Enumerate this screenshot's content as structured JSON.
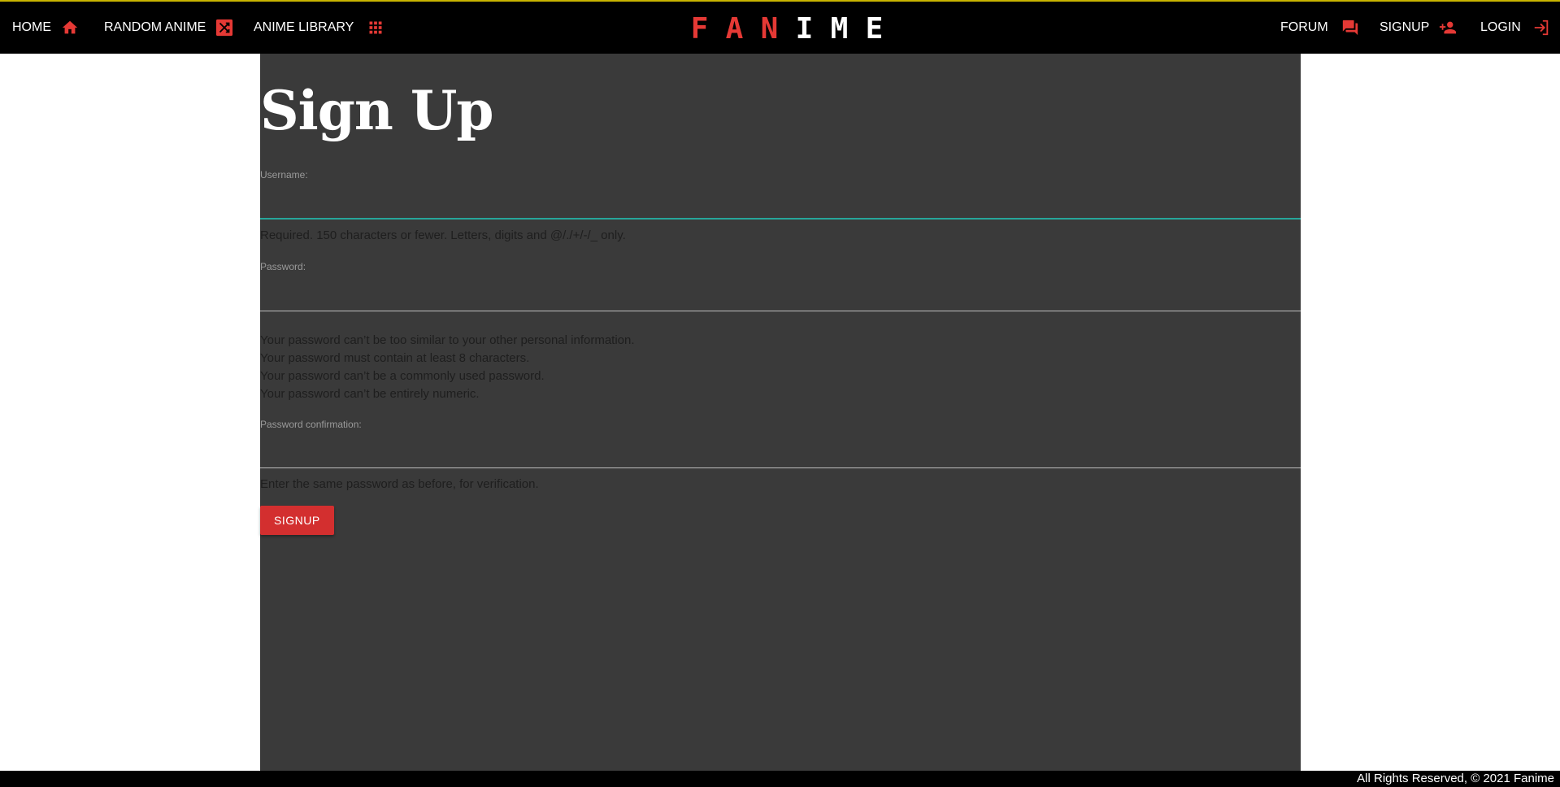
{
  "nav": {
    "left": [
      {
        "label": "HOME",
        "icon": "home-icon"
      },
      {
        "label": "RANDOM ANIME",
        "icon": "shuffle-icon"
      },
      {
        "label": "ANIME LIBRARY",
        "icon": "grid-icon"
      }
    ],
    "brand": [
      "F",
      "A",
      "N",
      "I",
      "M",
      "E"
    ],
    "right": [
      {
        "label": "FORUM",
        "icon": "forum-icon"
      },
      {
        "label": "SIGNUP",
        "icon": "person-add-icon"
      },
      {
        "label": "LOGIN",
        "icon": "login-icon"
      }
    ]
  },
  "form": {
    "title": "Sign Up",
    "username": {
      "label": "Username:",
      "value": "",
      "help": "Required. 150 characters or fewer. Letters, digits and @/./+/-/_ only."
    },
    "password": {
      "label": "Password:",
      "value": "",
      "help": [
        "Your password can’t be too similar to your other personal information.",
        "Your password must contain at least 8 characters.",
        "Your password can’t be a commonly used password.",
        "Your password can’t be entirely numeric."
      ]
    },
    "password_confirmation": {
      "label": "Password confirmation:",
      "value": "",
      "help": "Enter the same password as before, for verification."
    },
    "submit_label": "SIGNUP"
  },
  "footer": {
    "text": "All Rights Reserved, © 2021 Fanime"
  },
  "colors": {
    "accent": "#e53935",
    "button": "#d32f2f",
    "nav_bg": "#000000",
    "panel_bg": "#3a3a3a",
    "focus_underline": "#26a69a",
    "top_border": "#c8b400"
  }
}
